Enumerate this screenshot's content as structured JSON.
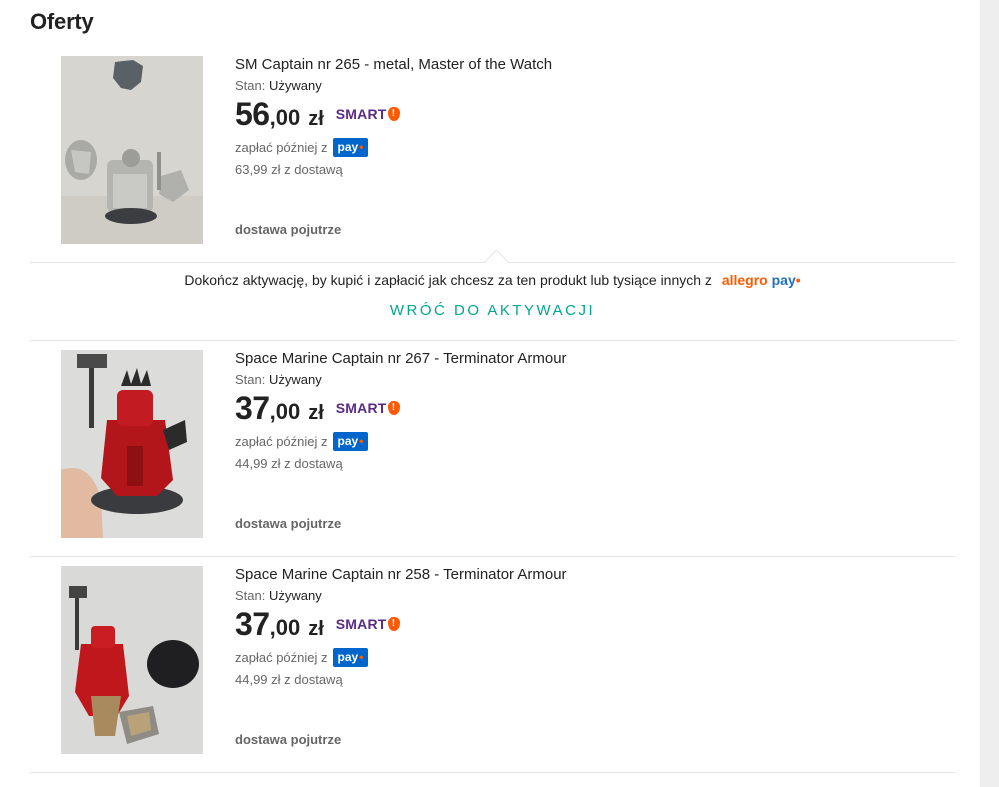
{
  "section": {
    "title": "Oferty"
  },
  "offers": [
    {
      "title": "SM Captain nr 265 - metal, Master of the Watch",
      "condition_label": "Stan:",
      "condition_value": "Używany",
      "price_int": "56",
      "price_dec": ",00",
      "currency": "zł",
      "smart_label": "SMART",
      "pay_later_text": "zapłać później z",
      "pay_badge": "pay",
      "total_with_delivery": "63,99 zł z dostawą",
      "delivery": "dostawa pojutrze",
      "image_icon": "miniature-photo-grey-metal"
    },
    {
      "title": "Space Marine Captain nr 267 - Terminator Armour",
      "condition_label": "Stan:",
      "condition_value": "Używany",
      "price_int": "37",
      "price_dec": ",00",
      "currency": "zł",
      "smart_label": "SMART",
      "pay_later_text": "zapłać później z",
      "pay_badge": "pay",
      "total_with_delivery": "44,99 zł z dostawą",
      "delivery": "dostawa pojutrze",
      "image_icon": "miniature-photo-red-painted"
    },
    {
      "title": "Space Marine Captain nr 258 - Terminator Armour",
      "condition_label": "Stan:",
      "condition_value": "Używany",
      "price_int": "37",
      "price_dec": ",00",
      "currency": "zł",
      "smart_label": "SMART",
      "pay_later_text": "zapłać później z",
      "pay_badge": "pay",
      "total_with_delivery": "44,99 zł z dostawą",
      "delivery": "dostawa pojutrze",
      "image_icon": "miniature-photo-red-with-base"
    }
  ],
  "activation": {
    "message": "Dokończ aktywację, by kupić i zapłacić jak chcesz za ten produkt lub tysiące innych z",
    "logo_allegro": "allegro",
    "logo_pay": "pay",
    "back_link": "WRÓĆ DO AKTYWACJI"
  },
  "colors": {
    "accent_teal": "#00a790",
    "allegro_orange": "#ff5a00",
    "pay_blue": "#0066cc",
    "smart_purple": "#5b2a86"
  }
}
